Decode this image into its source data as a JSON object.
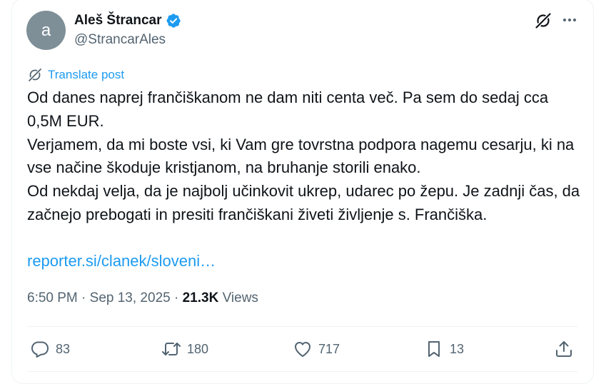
{
  "author": {
    "avatar_letter": "a",
    "name": "Aleš Štrancar",
    "handle": "@StrancarAles",
    "verified": true
  },
  "translate_label": "Translate post",
  "tweet": {
    "line1": "Od danes naprej frančiškanom ne dam niti centa več. Pa sem do sedaj cca 0,5M EUR.",
    "line2": "Verjamem, da mi boste vsi, ki Vam gre tovrstna podpora nagemu cesarju, ki na vse načine škoduje kristjanom, na bruhanje storili enako.",
    "line3": "Od nekdaj velja, da je najbolj učinkovit ukrep, udarec po žepu. Je zadnji čas, da začnejo prebogati in presiti frančiškani živeti življenje s. Frančiška.",
    "link": "reporter.si/clanek/sloveni…"
  },
  "meta": {
    "time": "6:50 PM",
    "dot1": " · ",
    "date": "Sep 13, 2025",
    "dot2": " · ",
    "views_count": "21.3K",
    "views_label": " Views"
  },
  "actions": {
    "replies": "83",
    "reposts": "180",
    "likes": "717",
    "bookmarks": "13"
  },
  "colors": {
    "accent": "#1d9bf0",
    "text": "#0f1419",
    "secondary": "#536471",
    "avatar_bg": "#7f8f98"
  }
}
